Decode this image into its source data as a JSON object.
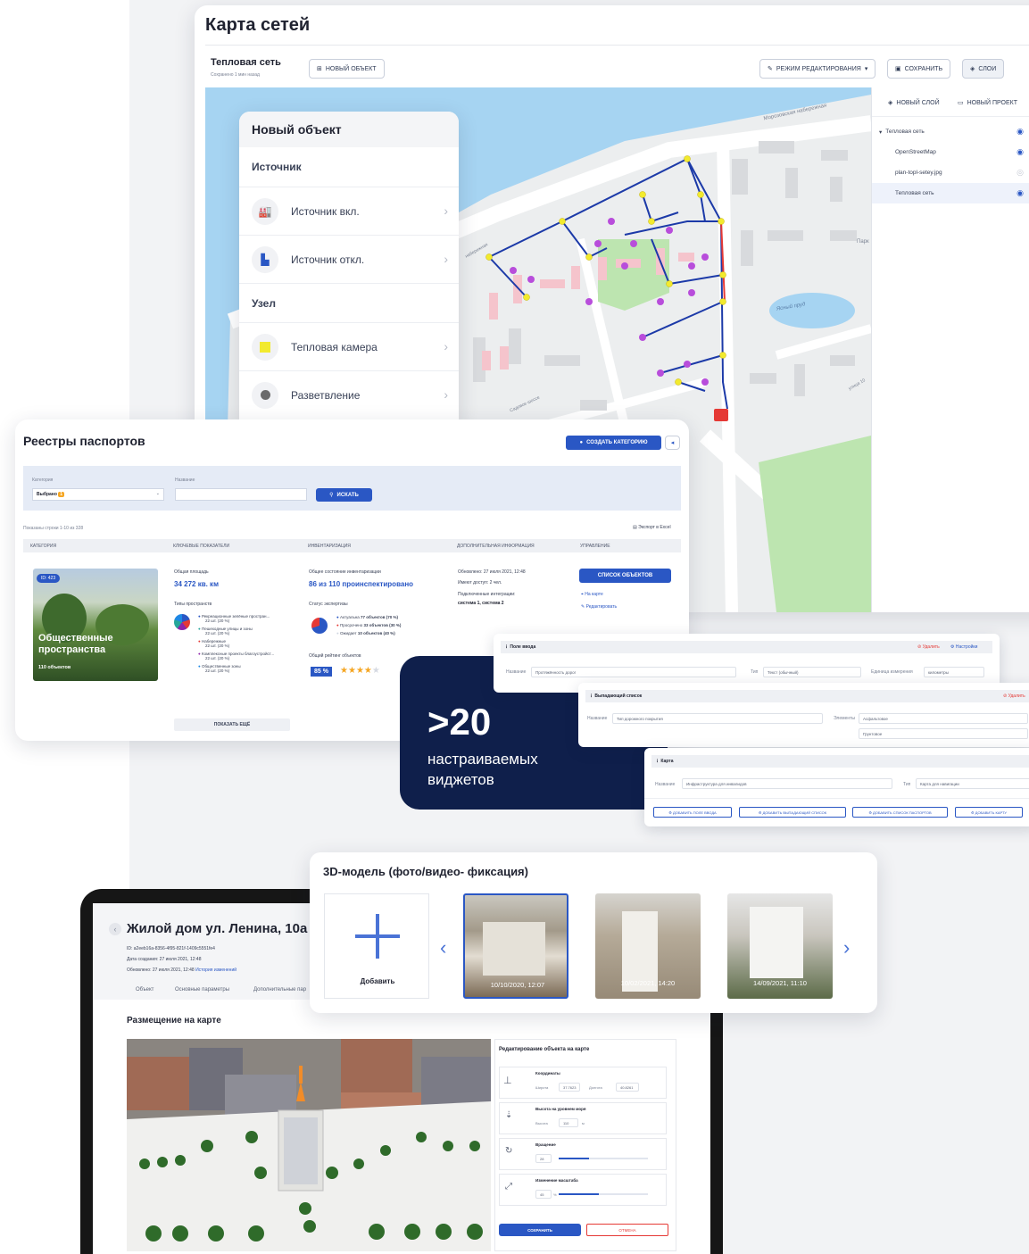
{
  "map": {
    "title": "Карта сетей",
    "network_name": "Тепловая сеть",
    "saved_note": "Сохранено 1 мин назад",
    "new_object_btn": "новый объект",
    "edit_mode_btn": "режим редактирования",
    "save_btn": "сохранить",
    "layers_btn": "слои",
    "new_layer_btn": "новый слой",
    "new_project_btn": "новый проект",
    "layers": [
      {
        "name": "Тепловая сеть"
      },
      {
        "name": "OpenStreetMap"
      },
      {
        "name": "plan-topl-setey.jpg"
      },
      {
        "name": "Тепловая сеть"
      }
    ],
    "street_embankment": "Морозовская набережная",
    "street_park": "Парк",
    "pond": "Ясный пруд",
    "street_right": "улица 10",
    "street_left": "набережная",
    "street_school": "Садовое шоссе"
  },
  "new_object": {
    "title": "Новый объект",
    "section1": "Источник",
    "items1": [
      {
        "label": "Источник вкл."
      },
      {
        "label": "Источник откл."
      }
    ],
    "section2": "Узел",
    "items2": [
      {
        "label": "Тепловая камера"
      },
      {
        "label": "Разветвление"
      }
    ]
  },
  "registry": {
    "title": "Реестры паспортов",
    "create_btn": "создать категорию",
    "filter_category_label": "Категория",
    "filter_category_value": "Выбрано",
    "filter_category_count": "1",
    "filter_name_label": "Название",
    "search_btn": "искать",
    "shown_rows": "Показаны строки 1-10 из 328",
    "export": "Экспорт в Excel",
    "columns": [
      "категория",
      "ключевые показатели",
      "инвентаризация",
      "дополнительная информация",
      "управление"
    ],
    "card_id": "ID: 423",
    "card_title": "Общественные пространства",
    "card_count": "110 объектов",
    "area_label": "Общая площадь",
    "area_value": "34 272 кв. км",
    "types_label": "Типы пространств",
    "types": [
      {
        "name": "Рекреационные зелёные простран...",
        "value": "22 шт. (20 %)",
        "color": "#2a57c4"
      },
      {
        "name": "Пешеходные улицы и зоны",
        "value": "22 шт. (20 %)",
        "color": "#26a69a"
      },
      {
        "name": "Набережные",
        "value": "22 шт. (20 %)",
        "color": "#e53935"
      },
      {
        "name": "Комплексные проекты благоустройст...",
        "value": "22 шт. (20 %)",
        "color": "#8e24aa"
      },
      {
        "name": "Общественные зоны",
        "value": "22 шт. (20 %)",
        "color": "#1e88e5"
      }
    ],
    "show_more": "показать ещё",
    "inv_label": "Общее состояние инвентаризации",
    "inv_value": "86 из 110 проинспектировано",
    "status_label": "Статус экспертизы",
    "statuses": [
      {
        "name": "Актуальна",
        "value": "77 объектов (70 %)",
        "color": "#2a57c4"
      },
      {
        "name": "Просрочено",
        "value": "33 объектов (30 %)",
        "color": "#e53935"
      },
      {
        "name": "Ожидает",
        "value": "10 объектов (40 %)",
        "color": "#cfd5e0"
      }
    ],
    "rating_label": "Общий рейтинг объектов",
    "rating_value": "85 %",
    "rating_stars": 4,
    "updated": "Обновлено: 27 июля 2021, 12:48",
    "access": "Имеют доступ: 2 чел.",
    "integrations_label": "Подключенные интеграции:",
    "integrations_value": "система 1, система 2",
    "list_btn": "список объектов",
    "on_map": "На карте",
    "edit": "Редактировать"
  },
  "widgets_promo": {
    "number": ">20",
    "line1": "настраиваемых",
    "line2": "виджетов"
  },
  "widgets": {
    "w1_title": "Поле ввода",
    "w1_delete": "Удалить",
    "w1_settings": "Настройки",
    "w1_name_label": "Название",
    "w1_name_value": "Протяжённость дорог",
    "w1_type_label": "Тип",
    "w1_type_value": "Текст (обычный)",
    "w1_unit_label": "Единица измерения",
    "w1_unit_value": "километры",
    "w2_title": "Выпадающий список",
    "w2_delete": "Удалить",
    "w2_name_label": "Название",
    "w2_name_value": "Тип дорожного покрытия",
    "w2_items_label": "Элементы",
    "w2_item1": "Асфальтовое",
    "w2_item2": "Грунтовое",
    "w3_title": "Карта",
    "w3_name_label": "Название",
    "w3_name_value": "Инфраструктура для инвалидов",
    "w3_type_label": "Тип",
    "w3_type_value": "Карта для навигации",
    "add_buttons": [
      "добавить поле ввода",
      "добавить выпадающий список",
      "добавить список паспортов",
      "добавить карту"
    ]
  },
  "model3d": {
    "title": "3D-модель (фото/видео- фиксация)",
    "add": "Добавить",
    "photos": [
      {
        "date": "10/10/2020, 12:07"
      },
      {
        "date": "10/02/2021, 14:20"
      },
      {
        "date": "14/09/2021, 11:10"
      }
    ]
  },
  "object_page": {
    "title": "Жилой дом ул. Ленина, 10а",
    "id": "ID: a2eeb16a-8356-4f95-821f-1409c5551fe4",
    "created": "Дата создания: 27 июля 2021, 12:48",
    "updated": "Обновлено: 27 июля 2021, 12:48",
    "history": "История изменений",
    "tabs": [
      "Объект",
      "Основные параметры",
      "Дополнительные пар"
    ],
    "map_section": "Размещение на карте",
    "edit_title": "Редактирование объекта на карте",
    "coords_label": "Координаты",
    "lat_label": "Широта",
    "lat_value": "37.7623",
    "lon_label": "Долгота",
    "lon_value": "40.8261",
    "height_label": "Высота на уровнем моря",
    "height_sub": "Высота",
    "height_value": "110",
    "height_unit": "м",
    "rotate_label": "Вращение",
    "rotate_value": "28",
    "scale_label": "Изменение масштаба",
    "scale_value": "45",
    "scale_unit": "%",
    "save_btn": "сохранить",
    "cancel_btn": "отмена"
  }
}
